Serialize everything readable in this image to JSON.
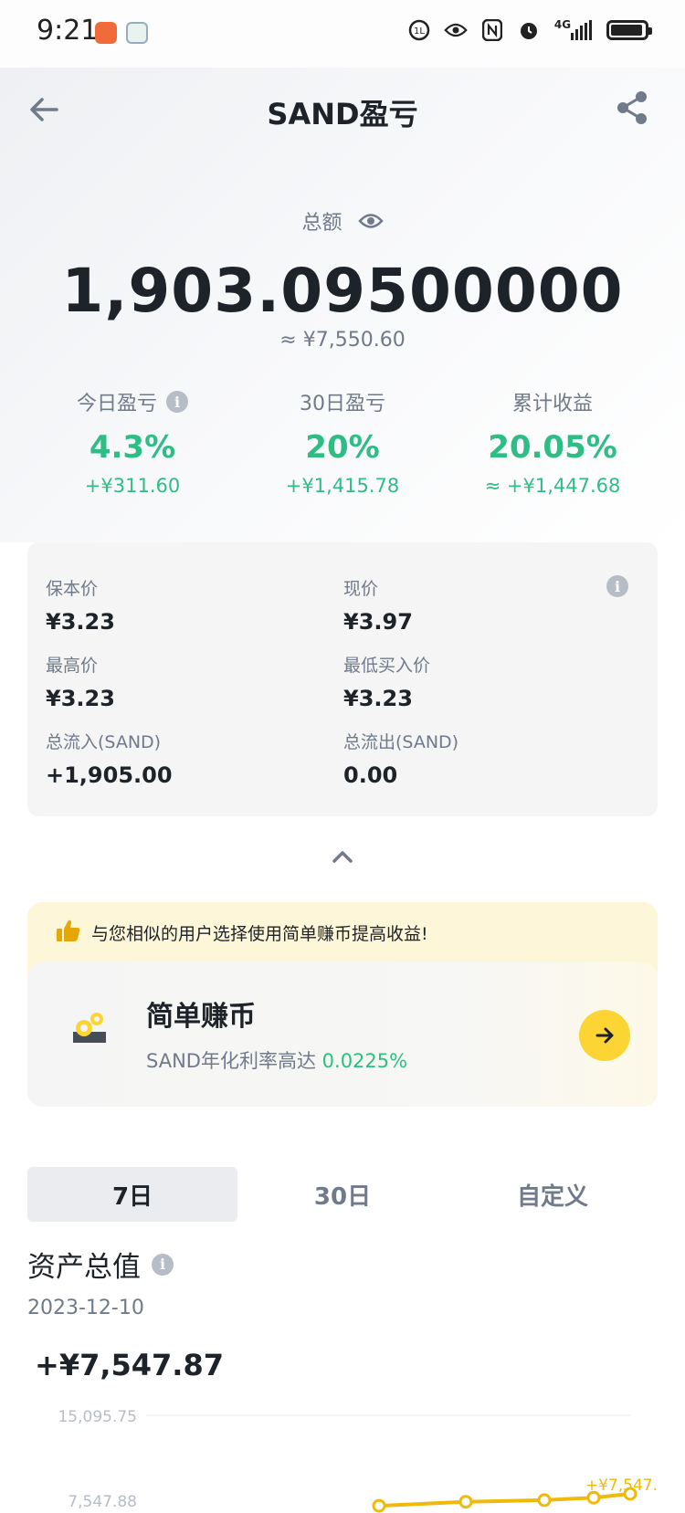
{
  "status_bar": {
    "time": "9:21",
    "network": "4G"
  },
  "header": {
    "title": "SAND盈亏"
  },
  "summary": {
    "total_label": "总额",
    "total_value": "1,903.09500000",
    "total_fiat": "≈ ¥7,550.60"
  },
  "stats": [
    {
      "label": "今日盈亏",
      "pct": "4.3%",
      "amount": "+¥311.60"
    },
    {
      "label": "30日盈亏",
      "pct": "20%",
      "amount": "+¥1,415.78"
    },
    {
      "label": "累计收益",
      "pct": "20.05%",
      "amount": "≈ +¥1,447.68"
    }
  ],
  "details": {
    "break_even_label": "保本价",
    "break_even_value": "¥3.23",
    "current_label": "现价",
    "current_value": "¥3.97",
    "highest_label": "最高价",
    "highest_value": "¥3.23",
    "lowest_buy_label": "最低买入价",
    "lowest_buy_value": "¥3.23",
    "inflow_label": "总流入(SAND)",
    "inflow_value": "+1,905.00",
    "outflow_label": "总流出(SAND)",
    "outflow_value": "0.00"
  },
  "promo": {
    "message": "与您相似的用户选择使用简单赚币提高收益!",
    "title": "简单赚币",
    "subtitle": "SAND年化利率高达",
    "rate": "0.0225%"
  },
  "tabs": [
    {
      "label": "7日",
      "active": true
    },
    {
      "label": "30日",
      "active": false
    },
    {
      "label": "自定义",
      "active": false
    }
  ],
  "asset": {
    "title": "资产总值",
    "date": "2023-12-10",
    "value": "+¥7,547.87"
  },
  "chart_data": {
    "type": "line",
    "y_ticks": [
      "15,095.75",
      "7,547.88"
    ],
    "values": [
      7400,
      7450,
      7470,
      7500,
      7547.87
    ],
    "end_label": "+¥7,547.",
    "color": "#f0b90b"
  },
  "colors": {
    "positive": "#2ebd85",
    "accent": "#fcd535",
    "muted": "#707a8a"
  }
}
